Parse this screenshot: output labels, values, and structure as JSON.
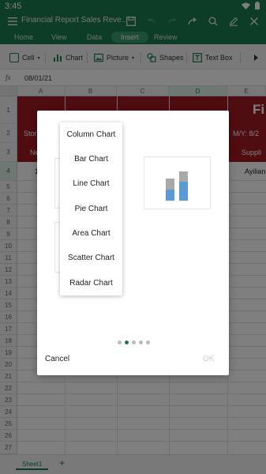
{
  "status": {
    "time": "3:45"
  },
  "app": {
    "title": "Financial Report Sales Reve...",
    "accent": "#1b7a4c",
    "header_red": "#a11b22"
  },
  "tabs": [
    {
      "label": "Home"
    },
    {
      "label": "View"
    },
    {
      "label": "Data"
    },
    {
      "label": "Insert",
      "active": true
    },
    {
      "label": "Review"
    }
  ],
  "toolbar": {
    "cell": "Cell",
    "chart": "Chart",
    "picture": "Picture",
    "shapes": "Shapes",
    "textbox": "Text Box"
  },
  "formula": {
    "fx": "fx",
    "value": "08/01/21"
  },
  "columns": [
    "A",
    "B",
    "C",
    "D",
    "E"
  ],
  "rows": [
    "1",
    "2",
    "3",
    "4",
    "5",
    "6",
    "7",
    "8",
    "9",
    "10",
    "11",
    "12",
    "13",
    "14",
    "15",
    "16",
    "17",
    "18",
    "19",
    "20",
    "21",
    "22",
    "23",
    "24",
    "25",
    "26",
    "27"
  ],
  "cells": {
    "r1_right": "Fi",
    "r2_left": "Stor",
    "r2_right": "M/Y:  8/2",
    "r3_left": "Ne",
    "r3_right": "Suppli",
    "r4_left": "1",
    "r4_right": "Ayilian"
  },
  "dialog": {
    "cancel": "Cancel",
    "ok": "OK",
    "page_count": 5,
    "active_page": 2,
    "preview_icon": "stacked-column-chart-icon",
    "colors": {
      "gray": "#a9a9a9",
      "blue": "#5b9bd5"
    }
  },
  "dropdown": {
    "items": [
      "Column Chart",
      "Bar Chart",
      "Line Chart",
      "Pie Chart",
      "Area Chart",
      "Scatter Chart",
      "Radar Chart"
    ]
  },
  "sheet": {
    "tab": "Sheet1",
    "add": "+"
  }
}
